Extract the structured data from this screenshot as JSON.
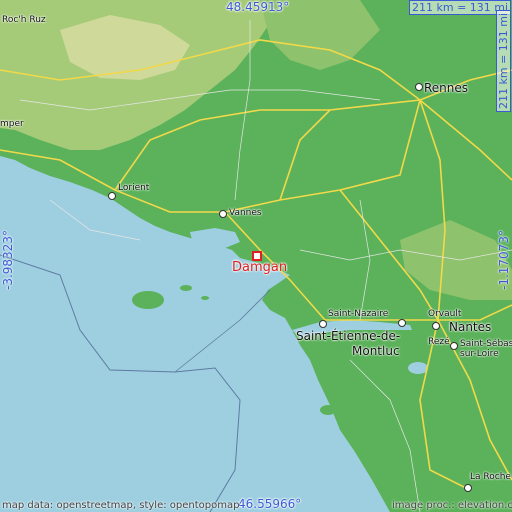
{
  "coordinates": {
    "north": "48.45913°",
    "south": "46.55966°",
    "west": "-3.98323°",
    "east": "-1.17073°"
  },
  "scale": {
    "horizontal": "211 km = 131 mi",
    "vertical": "211 km = 131 mi"
  },
  "highlight_city": "Damgan",
  "cities": {
    "rochruz": "Roc'h Ruz",
    "quimper": "mper",
    "rennes": "Rennes",
    "lorient": "Lorient",
    "vannes": "Vannes",
    "saint_nazaire": "Saint-Nazaire",
    "saint_etienne_1": "Saint-Étienne-de-",
    "saint_etienne_2": "Montluc",
    "orvault": "Orvault",
    "nantes": "Nantes",
    "reze": "Rezé",
    "saint_seb_1": "Saint-Sébas",
    "saint_seb_2": "sur-Loire",
    "la_roche": "La Roche"
  },
  "credits": {
    "left": "map data: openstreetmap, style: opentopomap",
    "right": "image proc.: elevation.city"
  },
  "colors": {
    "sea": "#9ecfe0",
    "lowland": "#4fae52",
    "highland": "#a9cd7a",
    "roads": "#f2d94a",
    "accent": "#3b5bd6",
    "highlight": "#e02020"
  }
}
